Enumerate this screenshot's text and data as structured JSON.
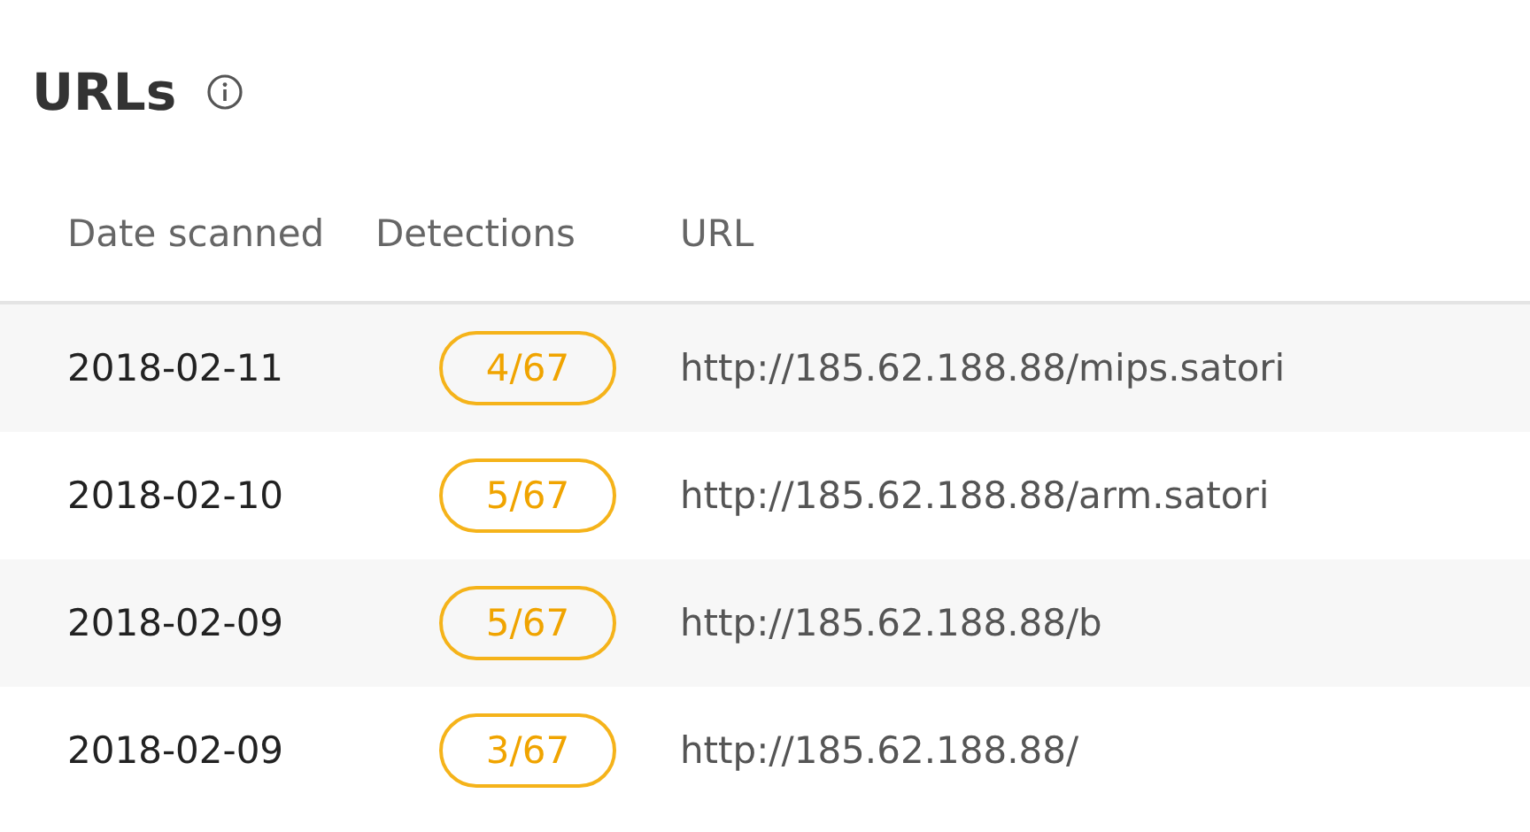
{
  "section": {
    "title": "URLs"
  },
  "table": {
    "columns": [
      "Date scanned",
      "Detections",
      "URL"
    ],
    "rows": [
      {
        "date": "2018-02-11",
        "detections": "4/67",
        "url": "http://185.62.188.88/mips.satori"
      },
      {
        "date": "2018-02-10",
        "detections": "5/67",
        "url": "http://185.62.188.88/arm.satori"
      },
      {
        "date": "2018-02-09",
        "detections": "5/67",
        "url": "http://185.62.188.88/b"
      },
      {
        "date": "2018-02-09",
        "detections": "3/67",
        "url": "http://185.62.188.88/"
      }
    ]
  }
}
